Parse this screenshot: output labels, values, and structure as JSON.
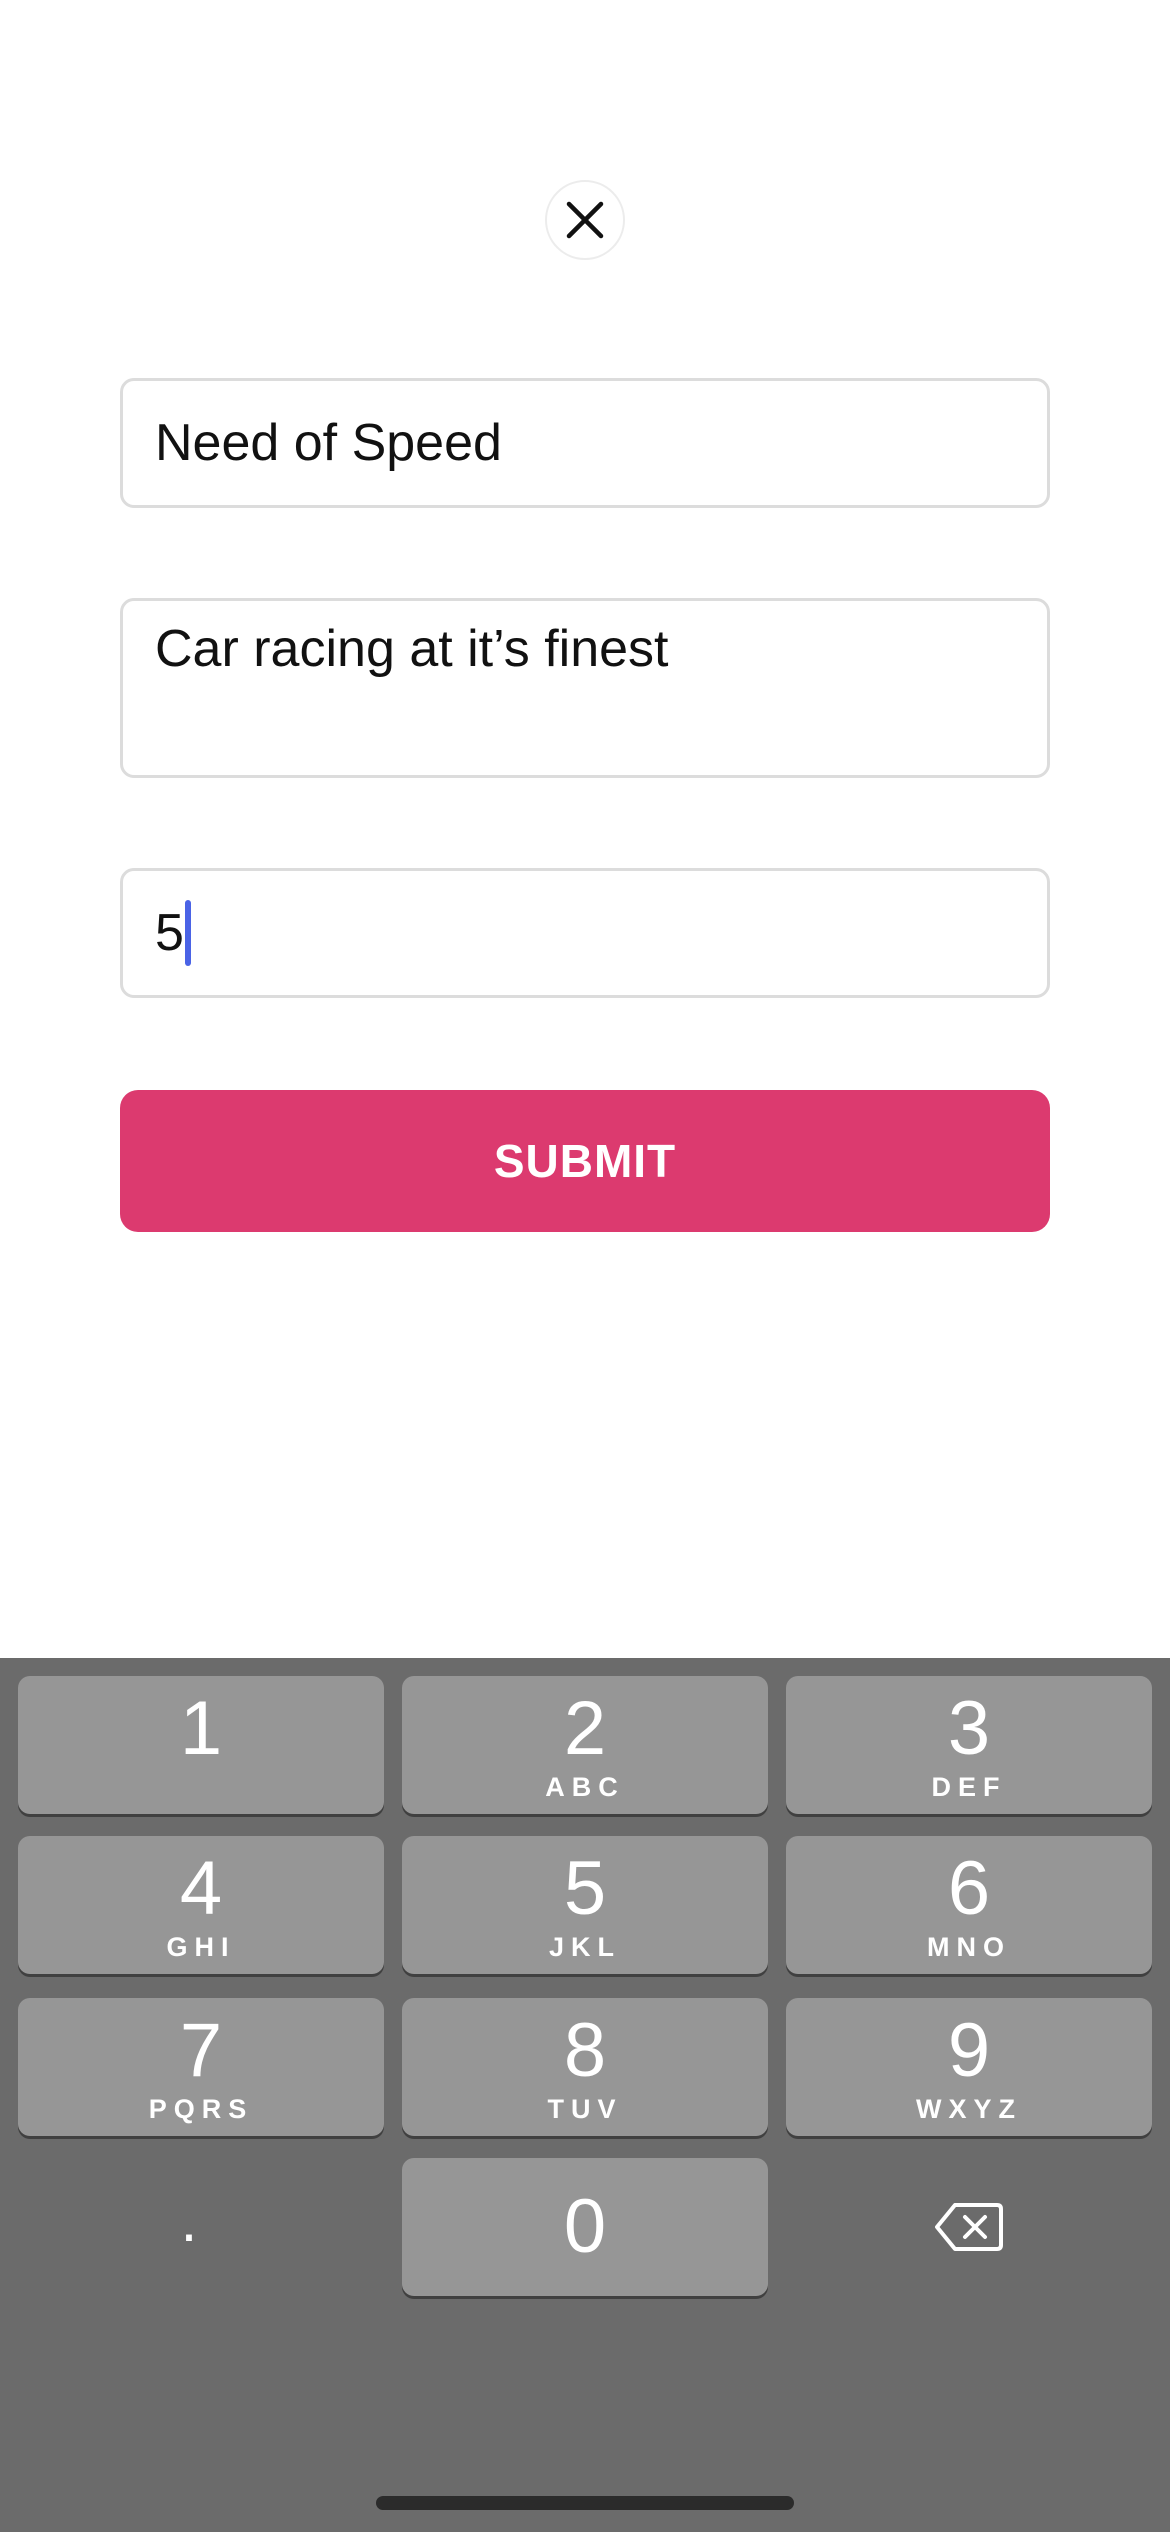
{
  "header": {
    "close_icon": "close-icon"
  },
  "form": {
    "title_value": "Need of Speed",
    "description_value": "Car racing at it’s finest",
    "rating_value": "5",
    "submit_label": "SUBMIT"
  },
  "colors": {
    "submit": "#dc3a6f",
    "caret": "#4a63e6",
    "keypad_bg": "#6b6b6b",
    "key_bg": "#969696"
  },
  "keypad": {
    "keys": [
      {
        "digit": "1",
        "letters": ""
      },
      {
        "digit": "2",
        "letters": "ABC"
      },
      {
        "digit": "3",
        "letters": "DEF"
      },
      {
        "digit": "4",
        "letters": "GHI"
      },
      {
        "digit": "5",
        "letters": "JKL"
      },
      {
        "digit": "6",
        "letters": "MNO"
      },
      {
        "digit": "7",
        "letters": "PQRS"
      },
      {
        "digit": "8",
        "letters": "TUV"
      },
      {
        "digit": "9",
        "letters": "WXYZ"
      },
      {
        "digit": "0",
        "letters": ""
      }
    ],
    "decimal_label": ".",
    "backspace_icon": "backspace-icon"
  }
}
